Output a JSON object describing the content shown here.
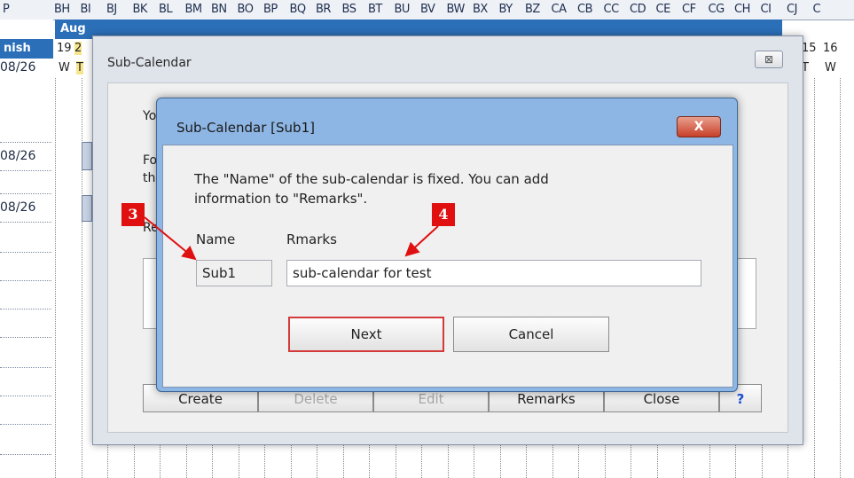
{
  "spreadsheet": {
    "col_headers": [
      "P",
      "BH",
      "BI",
      "BJ",
      "BK",
      "BL",
      "BM",
      "BN",
      "BO",
      "BP",
      "BQ",
      "BR",
      "BS",
      "BT",
      "BU",
      "BV",
      "BW",
      "BX",
      "BY",
      "BZ",
      "CA",
      "CB",
      "CC",
      "CD",
      "CE",
      "CF",
      "CG",
      "CH",
      "CI",
      "CJ",
      "C"
    ],
    "finish_label": "nish",
    "dates": [
      "08/26",
      "08/26",
      "08/26"
    ],
    "month_label": "Aug",
    "day_numbers": [
      "19",
      "2",
      "15",
      "16"
    ],
    "weekdays": [
      "W",
      "T",
      "T",
      "W"
    ]
  },
  "outer_dialog": {
    "title": "Sub-Calendar",
    "close_label": "⊠",
    "text_y": "Yo",
    "text_f": "Fo",
    "text_th": "th",
    "text_re": "Re",
    "buttons": {
      "create": "Create",
      "delete": "Delete",
      "edit": "Edit",
      "remarks": "Remarks",
      "close": "Close",
      "help": "?"
    }
  },
  "inner_dialog": {
    "title": "Sub-Calendar [Sub1]",
    "close_label": "X",
    "message_line1": "The \"Name\" of the sub-calendar is fixed. You can add",
    "message_line2": "information to \"Remarks\".",
    "name_label": "Name",
    "remarks_label": "Rmarks",
    "name_value": "Sub1",
    "remarks_value": "sub-calendar for test",
    "next_label": "Next",
    "cancel_label": "Cancel"
  },
  "annotations": {
    "badge3": "3",
    "badge4": "4",
    "color": "#e01010"
  }
}
